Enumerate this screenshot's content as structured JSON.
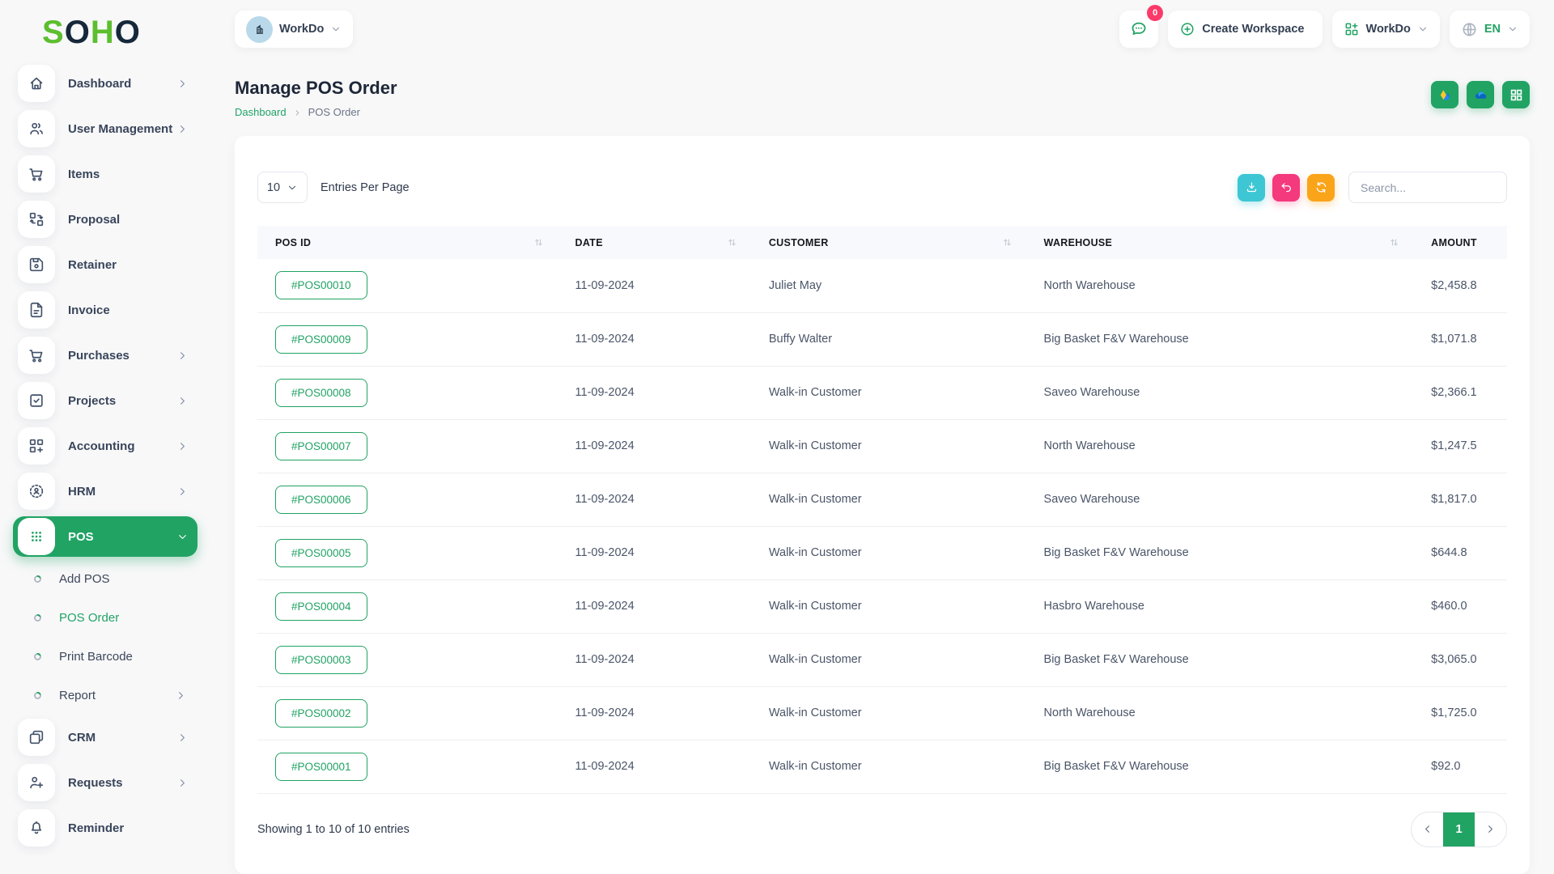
{
  "brand": {
    "logo_letters": [
      {
        "ch": "S",
        "color": "#5dbe2f"
      },
      {
        "ch": "O",
        "color": "#16283a"
      },
      {
        "ch": "H",
        "color": "#5dbe2f"
      },
      {
        "ch": "O",
        "color": "#16283a"
      }
    ]
  },
  "topbar": {
    "workspace_name": "WorkDo",
    "messages_badge": "0",
    "create_workspace_label": "Create Workspace",
    "apps_menu_label": "WorkDo",
    "language": "EN"
  },
  "sidebar": {
    "items": [
      {
        "t": "item",
        "label": "Dashboard",
        "icon": "home-icon",
        "chevron": "chevron-right-icon"
      },
      {
        "t": "item",
        "label": "User Management",
        "icon": "users-icon",
        "chevron": "chevron-right-icon"
      },
      {
        "t": "item",
        "label": "Items",
        "icon": "cart-icon"
      },
      {
        "t": "item",
        "label": "Proposal",
        "icon": "proposal-icon"
      },
      {
        "t": "item",
        "label": "Retainer",
        "icon": "retainer-icon"
      },
      {
        "t": "item",
        "label": "Invoice",
        "icon": "invoice-icon"
      },
      {
        "t": "item",
        "label": "Purchases",
        "icon": "cart-icon",
        "chevron": "chevron-right-icon"
      },
      {
        "t": "item",
        "label": "Projects",
        "icon": "projects-icon",
        "chevron": "chevron-right-icon"
      },
      {
        "t": "item",
        "label": "Accounting",
        "icon": "accounting-icon",
        "chevron": "chevron-right-icon"
      },
      {
        "t": "item",
        "label": "HRM",
        "icon": "hrm-icon",
        "chevron": "chevron-right-icon"
      },
      {
        "t": "item",
        "label": "POS",
        "icon": "pos-icon",
        "chevron": "chevron-down-icon",
        "active": true
      },
      {
        "t": "sub",
        "label": "Add POS",
        "sub": true
      },
      {
        "t": "sub",
        "label": "POS Order",
        "sub": true,
        "active": true
      },
      {
        "t": "sub",
        "label": "Print Barcode",
        "sub": true
      },
      {
        "t": "sub",
        "label": "Report",
        "sub": true,
        "chevron": "chevron-right-icon"
      },
      {
        "t": "item",
        "label": "CRM",
        "icon": "crm-icon",
        "chevron": "chevron-right-icon"
      },
      {
        "t": "item",
        "label": "Requests",
        "icon": "requests-icon",
        "chevron": "chevron-right-icon"
      },
      {
        "t": "item",
        "label": "Reminder",
        "icon": "bell-icon"
      }
    ]
  },
  "page": {
    "title": "Manage POS Order",
    "breadcrumb": {
      "home": "Dashboard",
      "current": "POS Order"
    },
    "quick_actions": [
      {
        "icon": "google-drive-icon"
      },
      {
        "icon": "onedrive-icon"
      },
      {
        "icon": "apps-grid-white-icon"
      }
    ]
  },
  "toolbar": {
    "entries_per_page_value": "10",
    "entries_per_page_label": "Entries Per Page",
    "action_buttons": [
      {
        "icon": "download-icon",
        "variant": "teal"
      },
      {
        "icon": "undo-icon",
        "variant": "pink"
      },
      {
        "icon": "refresh-icon",
        "variant": "orange"
      }
    ],
    "search_placeholder": "Search..."
  },
  "table": {
    "columns": [
      {
        "label": "POS ID",
        "sortable": true
      },
      {
        "label": "DATE",
        "sortable": true
      },
      {
        "label": "CUSTOMER",
        "sortable": true
      },
      {
        "label": "WAREHOUSE",
        "sortable": true
      },
      {
        "label": "AMOUNT",
        "sortable": false
      }
    ],
    "rows": [
      {
        "pos_id": "#POS00010",
        "date": "11-09-2024",
        "customer": "Juliet May",
        "warehouse": "North Warehouse",
        "amount": "$2,458.8"
      },
      {
        "pos_id": "#POS00009",
        "date": "11-09-2024",
        "customer": "Buffy Walter",
        "warehouse": "Big Basket F&V Warehouse",
        "amount": "$1,071.8"
      },
      {
        "pos_id": "#POS00008",
        "date": "11-09-2024",
        "customer": "Walk-in Customer",
        "warehouse": "Saveo Warehouse",
        "amount": "$2,366.1"
      },
      {
        "pos_id": "#POS00007",
        "date": "11-09-2024",
        "customer": "Walk-in Customer",
        "warehouse": "North Warehouse",
        "amount": "$1,247.5"
      },
      {
        "pos_id": "#POS00006",
        "date": "11-09-2024",
        "customer": "Walk-in Customer",
        "warehouse": "Saveo Warehouse",
        "amount": "$1,817.0"
      },
      {
        "pos_id": "#POS00005",
        "date": "11-09-2024",
        "customer": "Walk-in Customer",
        "warehouse": "Big Basket F&V Warehouse",
        "amount": "$644.8"
      },
      {
        "pos_id": "#POS00004",
        "date": "11-09-2024",
        "customer": "Walk-in Customer",
        "warehouse": "Hasbro Warehouse",
        "amount": "$460.0"
      },
      {
        "pos_id": "#POS00003",
        "date": "11-09-2024",
        "customer": "Walk-in Customer",
        "warehouse": "Big Basket F&V Warehouse",
        "amount": "$3,065.0"
      },
      {
        "pos_id": "#POS00002",
        "date": "11-09-2024",
        "customer": "Walk-in Customer",
        "warehouse": "North Warehouse",
        "amount": "$1,725.0"
      },
      {
        "pos_id": "#POS00001",
        "date": "11-09-2024",
        "customer": "Walk-in Customer",
        "warehouse": "Big Basket F&V Warehouse",
        "amount": "$92.0"
      }
    ]
  },
  "footer": {
    "showing_text": "Showing 1 to 10 of 10 entries",
    "current_page": "1"
  },
  "colors": {
    "primary_green": "#21a364",
    "logo_green": "#5dbe2f",
    "logo_navy": "#16283a",
    "badge_pink": "#fb3a6a",
    "button_teal": "#3dc6d4",
    "button_pink": "#f4397c",
    "button_orange": "#faa41a",
    "drive_yellow": "#ffc107",
    "drive_blue": "#2684fc",
    "onedrive_blue": "#0364b8"
  }
}
